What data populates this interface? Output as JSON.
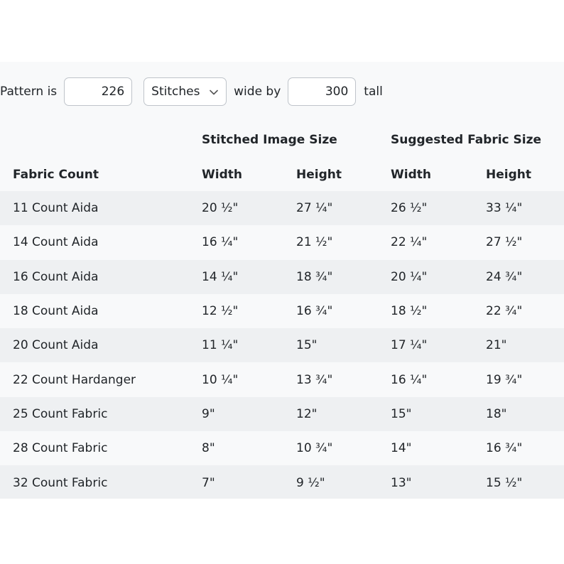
{
  "controls": {
    "prefix": "Pattern is",
    "width_value": "226",
    "unit_selected": "Stitches",
    "middle": "wide by",
    "height_value": "300",
    "suffix": "tall"
  },
  "table": {
    "group_headers": {
      "stitched": "Stitched Image Size",
      "suggested": "Suggested Fabric Size"
    },
    "columns": {
      "fabric_count": "Fabric Count",
      "stitched_width": "Width",
      "stitched_height": "Height",
      "suggested_width": "Width",
      "suggested_height": "Height"
    },
    "rows": [
      [
        "11 Count Aida",
        "20 ½\"",
        "27 ¼\"",
        "26 ½\"",
        "33 ¼\""
      ],
      [
        "14 Count Aida",
        "16 ¼\"",
        "21 ½\"",
        "22 ¼\"",
        "27 ½\""
      ],
      [
        "16 Count Aida",
        "14 ¼\"",
        "18 ¾\"",
        "20 ¼\"",
        "24 ¾\""
      ],
      [
        "18 Count Aida",
        "12 ½\"",
        "16 ¾\"",
        "18 ½\"",
        "22 ¾\""
      ],
      [
        "20 Count Aida",
        "11 ¼\"",
        "15\"",
        "17 ¼\"",
        "21\""
      ],
      [
        "22 Count Hardanger",
        "10 ¼\"",
        "13 ¾\"",
        "16 ¼\"",
        "19 ¾\""
      ],
      [
        "25 Count Fabric",
        "9\"",
        "12\"",
        "15\"",
        "18\""
      ],
      [
        "28 Count Fabric",
        "8\"",
        "10 ¾\"",
        "14\"",
        "16 ¾\""
      ],
      [
        "32 Count Fabric",
        "7\"",
        "9 ½\"",
        "13\"",
        "15 ½\""
      ]
    ]
  }
}
